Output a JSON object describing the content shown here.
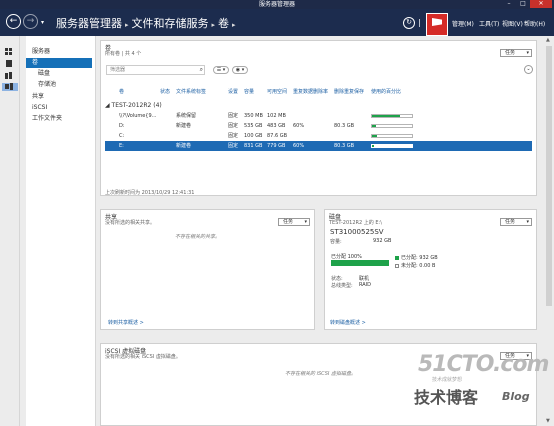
{
  "window": {
    "title": "服务器管理器"
  },
  "nav": {
    "breadcrumb": [
      "服务器管理器",
      "文件和存储服务",
      "卷"
    ],
    "menu": [
      "管理(M)",
      "工具(T)",
      "视图(V)",
      "帮助(H)"
    ]
  },
  "subnav": {
    "items": [
      "服务器",
      "卷",
      "磁盘",
      "存储池",
      "共享",
      "iSCSI",
      "工作文件夹"
    ]
  },
  "volumes": {
    "title": "卷",
    "subtitle": "所有卷 | 共 4 个",
    "tasks": "任务",
    "filter_placeholder": "筛选器",
    "columns": [
      "卷",
      "状态",
      "文件系统标签",
      "设置",
      "容量",
      "可用空间",
      "重复数据删除率",
      "删除重复保存",
      "使用的百分比"
    ],
    "group": "TEST-2012R2 (4)",
    "rows": [
      {
        "vol": "\\\\?\\Volume{9...",
        "status": "",
        "label": "系统保留",
        "prov": "固定",
        "cap": "350 MB",
        "free": "102 MB",
        "rate": "",
        "saved": "",
        "usage": 0.71
      },
      {
        "vol": "D:",
        "status": "",
        "label": "新建卷",
        "prov": "固定",
        "cap": "535 GB",
        "free": "483 GB",
        "rate": "60%",
        "saved": "80.3 GB",
        "usage": 0.1
      },
      {
        "vol": "C:",
        "status": "",
        "label": "",
        "prov": "固定",
        "cap": "100 GB",
        "free": "87.6 GB",
        "rate": "",
        "saved": "",
        "usage": 0.12
      },
      {
        "vol": "E:",
        "status": "",
        "label": "新建卷",
        "prov": "固定",
        "cap": "831 GB",
        "free": "779 GB",
        "rate": "60%",
        "saved": "80.3 GB",
        "usage": 0.06
      }
    ],
    "refreshed": "上次刷新时间为 2013/10/29 12:41:31"
  },
  "shares": {
    "title": "共享",
    "subtitle": "没有所选的相关共享。",
    "tasks": "任务",
    "empty": "不存在相关的共享。",
    "link": "转到共享概述 >"
  },
  "disk": {
    "title": "磁盘",
    "subtitle": "TEST-2012R2 上的 E:\\",
    "tasks": "任务",
    "name": "ST31000525SV",
    "capacity_label": "容量:",
    "capacity": "932 GB",
    "allocated_label": "已分配 100%",
    "allocated_fraction": 1.0,
    "legend_alloc": "已分配: 932 GB",
    "legend_unalloc": "未分配: 0.00 B",
    "status_label": "状态:",
    "status": "联机",
    "type_label": "总线类型:",
    "type": "RAID",
    "link": "转到磁盘概述 >",
    "alloc_color": "#1ea24a"
  },
  "iscsi": {
    "title": "iSCSI 虚拟磁盘",
    "subtitle": "没有所选的相关 iSCSI 虚拟磁盘。",
    "tasks": "任务",
    "empty": "不存在相关的 iSCSI 虚拟磁盘。"
  },
  "watermark": {
    "big": "51CTO.com",
    "small": "技术成就梦想",
    "cn": "技术博客",
    "blog": "Blog"
  }
}
